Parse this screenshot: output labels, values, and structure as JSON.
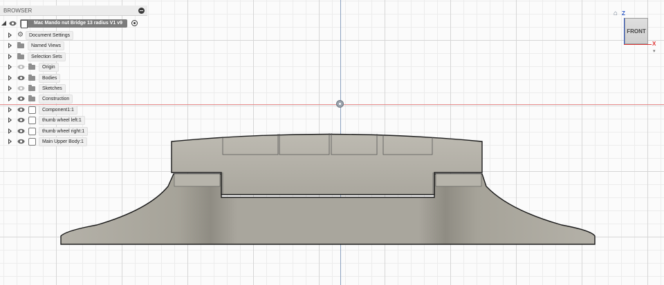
{
  "browser": {
    "title": "BROWSER",
    "root": {
      "label": "Mac Mando nut Bridge 13 radius V1 v9"
    },
    "items": [
      {
        "label": "Document Settings",
        "icon": "gear-icon",
        "eye": "none",
        "kind": "settings"
      },
      {
        "label": "Named Views",
        "icon": "folder-icon",
        "eye": "none",
        "kind": "folder"
      },
      {
        "label": "Selection Sets",
        "icon": "folder-icon",
        "eye": "none",
        "kind": "folder"
      },
      {
        "label": "Origin",
        "icon": "folder-icon",
        "eye": "hidden",
        "kind": "folder"
      },
      {
        "label": "Bodies",
        "icon": "folder-icon",
        "eye": "visible",
        "kind": "folder"
      },
      {
        "label": "Sketches",
        "icon": "folder-icon",
        "eye": "hidden",
        "kind": "folder"
      },
      {
        "label": "Construction",
        "icon": "folder-icon",
        "eye": "visible",
        "kind": "folder"
      },
      {
        "label": "Component1:1",
        "icon": "component-icon",
        "eye": "visible",
        "kind": "component"
      },
      {
        "label": "thumb wheel left:1",
        "icon": "component-icon",
        "eye": "visible",
        "kind": "component"
      },
      {
        "label": "thumb wheel right:1",
        "icon": "component-icon",
        "eye": "visible",
        "kind": "component"
      },
      {
        "label": "Main Upper Body:1",
        "icon": "component-icon",
        "eye": "visible",
        "kind": "component"
      }
    ]
  },
  "viewcube": {
    "face_label": "FRONT",
    "z_label": "Z",
    "x_label": "X"
  },
  "colors": {
    "body_fill": "#a8a59c",
    "body_outline": "#1a1a1a",
    "axis_red": "#e58a8a",
    "axis_blue": "#8aa0bf"
  }
}
